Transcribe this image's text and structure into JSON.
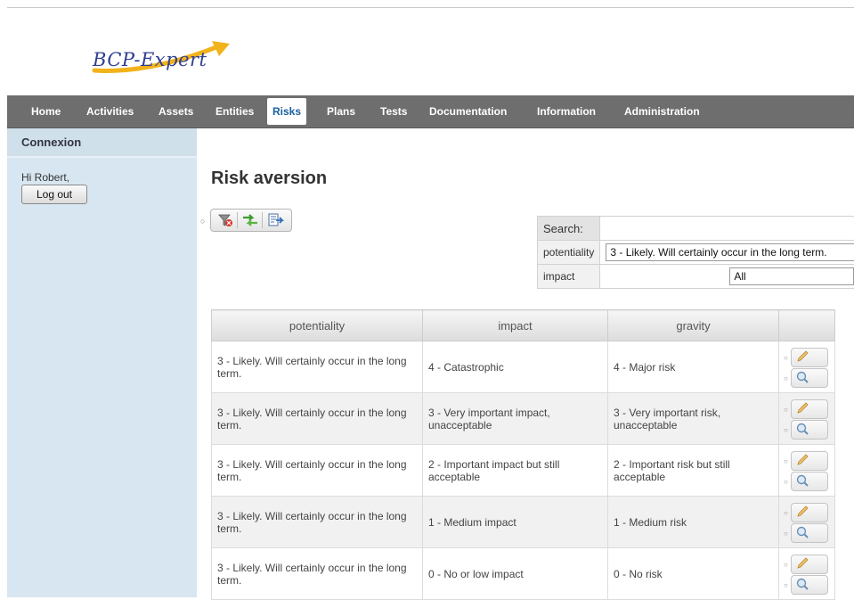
{
  "app": {
    "logo_text": "BCP-Expert"
  },
  "nav": {
    "items": [
      {
        "label": "Home"
      },
      {
        "label": "Activities"
      },
      {
        "label": "Assets"
      },
      {
        "label": "Entities"
      },
      {
        "label": "Risks",
        "active": true
      },
      {
        "label": "Plans"
      },
      {
        "label": "Tests"
      },
      {
        "label": "Documentation"
      },
      {
        "label": "Information"
      },
      {
        "label": "Administration"
      }
    ]
  },
  "sidebar": {
    "title": "Connexion",
    "greeting": "Hi Robert,",
    "logout_label": "Log out"
  },
  "page": {
    "title": "Risk aversion"
  },
  "toolbar": {
    "icons": [
      "filter-clear-icon",
      "swap-arrows-icon",
      "export-icon"
    ]
  },
  "search": {
    "label": "Search:",
    "filters": [
      {
        "label": "potentiality",
        "value": "3 - Likely. Will certainly occur in the long term."
      },
      {
        "label": "impact",
        "value": "All"
      }
    ]
  },
  "table": {
    "columns": [
      "potentiality",
      "impact",
      "gravity"
    ],
    "rows": [
      {
        "potentiality": "3 - Likely. Will certainly occur in the long term.",
        "impact": "4 - Catastrophic",
        "gravity": "4 - Major risk"
      },
      {
        "potentiality": "3 - Likely. Will certainly occur in the long term.",
        "impact": "3 - Very important impact, unacceptable",
        "gravity": "3 - Very important risk, unacceptable"
      },
      {
        "potentiality": "3 - Likely. Will certainly occur in the long term.",
        "impact": "2 - Important impact but still acceptable",
        "gravity": "2 - Important risk but still acceptable"
      },
      {
        "potentiality": "3 - Likely. Will certainly occur in the long term.",
        "impact": "1 - Medium impact",
        "gravity": "1 - Medium risk"
      },
      {
        "potentiality": "3 - Likely. Will certainly occur in the long term.",
        "impact": "0 - No or low impact",
        "gravity": "0 - No risk"
      }
    ],
    "row_actions": [
      "pencil-icon",
      "magnifier-icon"
    ]
  },
  "colors": {
    "nav_bg": "#6e6e6e",
    "sidebar_bg": "#d7e6f0",
    "active_tab_text": "#1a5f9e",
    "logo_blue": "#2f3f8f",
    "logo_swoosh": "#f2b21b"
  }
}
